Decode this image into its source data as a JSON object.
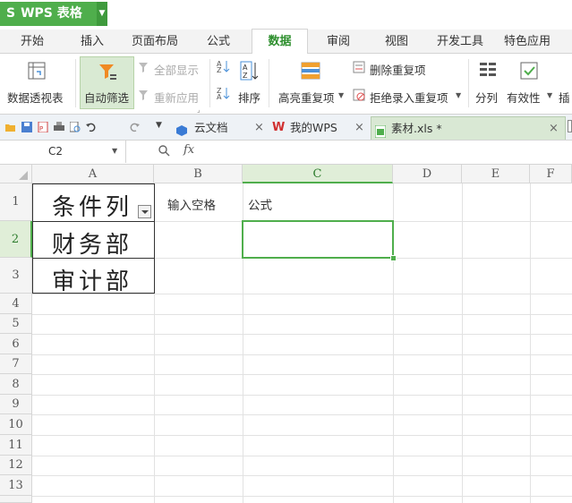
{
  "app": {
    "name": "WPS 表格"
  },
  "tabs": [
    "开始",
    "插入",
    "页面布局",
    "公式",
    "数据",
    "审阅",
    "视图",
    "开发工具",
    "特色应用"
  ],
  "active_tab": "数据",
  "ribbon": {
    "pivot": "数据透视表",
    "autofilter": "自动筛选",
    "show_all": "全部显示",
    "reapply": "重新应用",
    "sort": "排序",
    "highlight_dup": "高亮重复项",
    "remove_dup": "删除重复项",
    "reject_dup": "拒绝录入重复项",
    "split": "分列",
    "validity": "有效性",
    "insert": "插"
  },
  "doc_tabs": [
    {
      "label": "云文档"
    },
    {
      "label": "我的WPS"
    },
    {
      "label": "素材.xls *"
    }
  ],
  "formula_bar": {
    "cell_ref": "C2",
    "fx": "fx"
  },
  "columns": [
    "A",
    "B",
    "C",
    "D",
    "E",
    "F"
  ],
  "rows": [
    "1",
    "2",
    "3",
    "4",
    "5",
    "6",
    "7",
    "8",
    "9",
    "10",
    "11",
    "12",
    "13"
  ],
  "cells": {
    "A1": "条件列",
    "A2": "财务部",
    "A3": "审计部",
    "B1": "输入空格",
    "C1": "公式"
  },
  "colors": {
    "accent": "#4fae4c",
    "selection": "#4fae4c"
  }
}
